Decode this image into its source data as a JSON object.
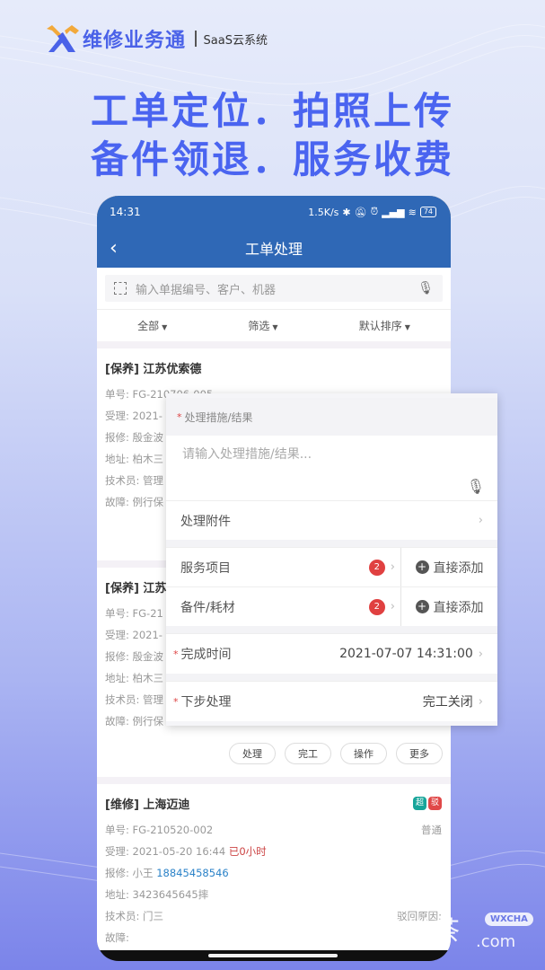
{
  "brand": {
    "name": "维修业务通",
    "subtitle": "SaaS云系统",
    "accent": "#4a62e8"
  },
  "headline": {
    "line1": "工单定位．拍照上传",
    "line2": "备件领退．服务收费"
  },
  "statusbar": {
    "time": "14:31",
    "speed": "1.5K/s",
    "battery": "74"
  },
  "nav": {
    "title": "工单处理"
  },
  "search": {
    "placeholder": "输入单据编号、客户、机器"
  },
  "filters": [
    {
      "label": "全部"
    },
    {
      "label": "筛选"
    },
    {
      "label": "默认排序"
    }
  ],
  "cards": [
    {
      "title": "[保养] 江苏优索德",
      "rows": [
        "单号: FG-210706-005",
        "受理: 2021-",
        "报修: 殷金波",
        "地址: 柏木三",
        "技术员: 管理",
        "故障: 例行保"
      ]
    },
    {
      "title": "[保养] 江苏",
      "rows": [
        "单号: FG-21",
        "受理: 2021-",
        "报修: 殷金波",
        "地址: 柏木三",
        "技术员: 管理",
        "故障: 例行保"
      ],
      "actions": [
        "处理",
        "完工",
        "操作",
        "更多"
      ]
    },
    {
      "title": "[维修] 上海迈迪",
      "tags": [
        {
          "label": "超",
          "color": "#17a59a"
        },
        {
          "label": "驳",
          "color": "#e04848"
        }
      ],
      "number": "单号: FG-210520-002",
      "priority": "普通",
      "accept_label": "受理: 2021-05-20 16:44",
      "elapsed": "已0小时",
      "reporter_label": "报修: 小王",
      "phone": "18845458546",
      "address": "地址: 3423645645摔",
      "technician": "技术员: 门三",
      "reject_reason": "驳回原因:",
      "fault": "故障:"
    }
  ],
  "popup": {
    "measure_label": "处理措施/结果",
    "measure_placeholder": "请输入处理措施/结果...",
    "attachment_label": "处理附件",
    "service_label": "服务项目",
    "service_count": "2",
    "parts_label": "备件/耗材",
    "parts_count": "2",
    "add_label": "直接添加",
    "finish_time_label": "完成时间",
    "finish_time_value": "2021-07-07 14:31:00",
    "next_step_label": "下步处理",
    "next_step_value": "完工关闭"
  },
  "watermark": {
    "text": "微茶",
    "badge": "WXCHA",
    "domain": ".com"
  }
}
